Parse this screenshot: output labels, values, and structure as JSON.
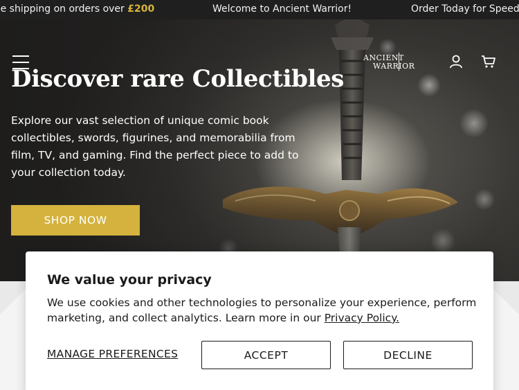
{
  "announcement": {
    "msg1_text": "ee shipping on orders over ",
    "msg1_amount": "£200",
    "msg2": "Welcome to Ancient Warrior!",
    "msg3": "Order Today for Speed"
  },
  "header": {
    "logo_line1": "ANCIENT",
    "logo_line2": "WARRIOR",
    "icons": [
      "menu-icon",
      "account-icon",
      "cart-icon"
    ]
  },
  "hero": {
    "title": "Discover rare Collectibles",
    "text": "Explore our vast selection of unique comic book collectibles, swords, figurines, and memorabilia from film, TV, and gaming. Find the perfect piece to add to your collection today.",
    "cta": "SHOP NOW"
  },
  "cookie": {
    "title": "We value your privacy",
    "text": "We use cookies and other technologies to personalize your experience, perform marketing, and collect analytics. Learn more in our ",
    "link": "Privacy Policy.",
    "manage": "MANAGE PREFERENCES",
    "accept": "ACCEPT",
    "decline": "DECLINE"
  },
  "colors": {
    "accent": "#d4b23d",
    "topbar_bg": "#1f1f1f",
    "price_accent": "#d8b43a"
  }
}
